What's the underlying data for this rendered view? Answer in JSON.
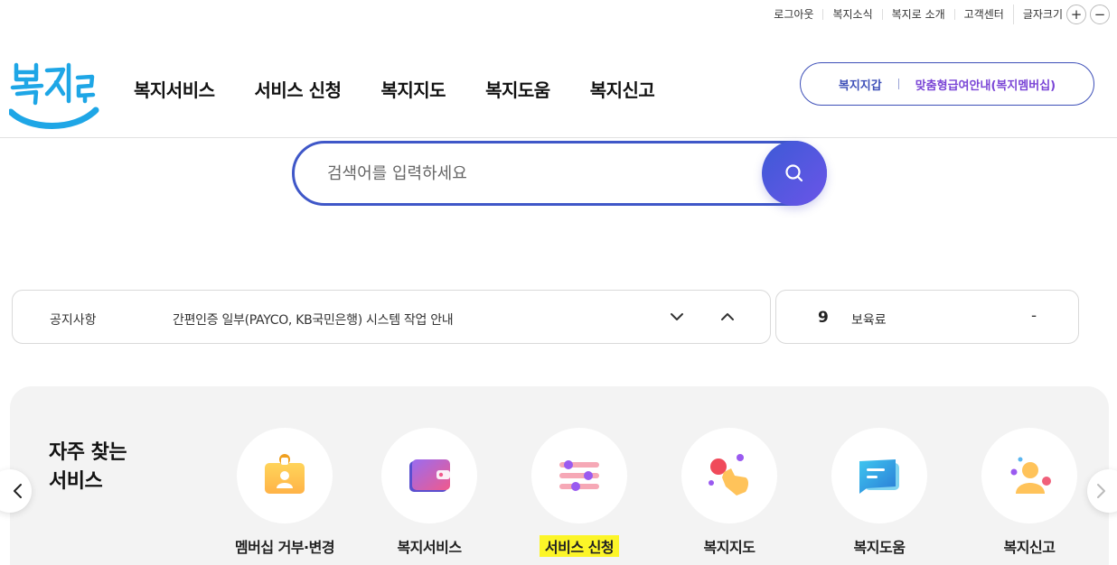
{
  "util": {
    "logout": "로그아웃",
    "news": "복지소식",
    "about": "복지로 소개",
    "support": "고객센터",
    "font_size": "글자크기",
    "plus": "+",
    "minus": "−"
  },
  "logo": {
    "alt": "복지로",
    "text": "복지로",
    "brand_color": "#1ea6e6"
  },
  "gnb": [
    "복지서비스",
    "서비스 신청",
    "복지지도",
    "복지도움",
    "복지신고"
  ],
  "pill": {
    "wallet": "복지지갑",
    "custom": "맞춤형급여안내(복지멤버십)"
  },
  "search": {
    "placeholder": "검색어를 입력하세요"
  },
  "notice": {
    "label": "공지사항",
    "text": "간편인증 일부(PAYCO, KB국민은행) 시스템 작업 안내"
  },
  "rank": {
    "number": "9",
    "text": "보육료",
    "change": "-"
  },
  "frequent": {
    "title_line1": "자주 찾는",
    "title_line2": "서비스",
    "items": [
      {
        "label": "멤버십 거부·변경",
        "icon": "id-card-icon"
      },
      {
        "label": "복지서비스",
        "icon": "wallet-icon"
      },
      {
        "label": "서비스 신청",
        "icon": "sliders-icon",
        "highlight": true
      },
      {
        "label": "복지지도",
        "icon": "map-pointer-icon"
      },
      {
        "label": "복지도움",
        "icon": "chat-icon"
      },
      {
        "label": "복지신고",
        "icon": "person-icon"
      }
    ]
  },
  "colors": {
    "primary": "#3f57c8",
    "highlight": "#fcf528",
    "purple": "#7a45d6"
  }
}
